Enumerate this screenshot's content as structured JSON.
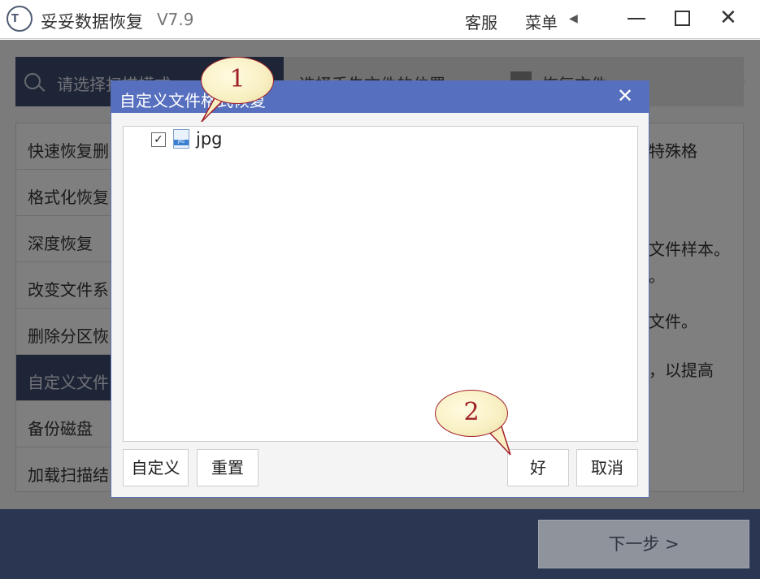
{
  "app": {
    "title": "妥妥数据恢复",
    "version": "V7.9",
    "logo_text": "T",
    "service_label": "客服",
    "menu_label": "菜单",
    "menu_arrow": "◀",
    "close_glyph": "✕"
  },
  "steps": [
    {
      "label": "请选择扫描模式",
      "icon": "search-icon"
    },
    {
      "label": "选择丢失文件的位置"
    },
    {
      "label": "恢复文件",
      "icon": "file-icon"
    }
  ],
  "modes": [
    {
      "label": "快速恢复删"
    },
    {
      "label": "格式化恢复"
    },
    {
      "label": "深度恢复"
    },
    {
      "label": "改变文件系"
    },
    {
      "label": "删除分区恢"
    },
    {
      "label": "自定义文件",
      "active": true
    },
    {
      "label": "备份磁盘"
    },
    {
      "label": "加载扫描结"
    }
  ],
  "mode_description_fragments": [
    "特殊格",
    "文件样本。",
    "。",
    "文件。",
    "，以提高"
  ],
  "footer": {
    "next_label": "下一步 >"
  },
  "dialog": {
    "title": "自定义文件格式恢复",
    "close_glyph": "✕",
    "files": [
      {
        "name": "jpg",
        "checked": true,
        "check_glyph": "✓",
        "icon": "jpg-file-icon",
        "icon_text": "JPG"
      }
    ],
    "buttons": {
      "custom": "自定义",
      "reset": "重置",
      "ok": "好",
      "cancel": "取消"
    }
  },
  "callouts": [
    {
      "number": "1"
    },
    {
      "number": "2"
    }
  ],
  "colors": {
    "dialog_header": "#566fbe",
    "nav_active": "#3c4a6e",
    "footer_bg": "#2b3653",
    "callout_fill": "#f8efc2",
    "callout_border": "#a2202a"
  }
}
